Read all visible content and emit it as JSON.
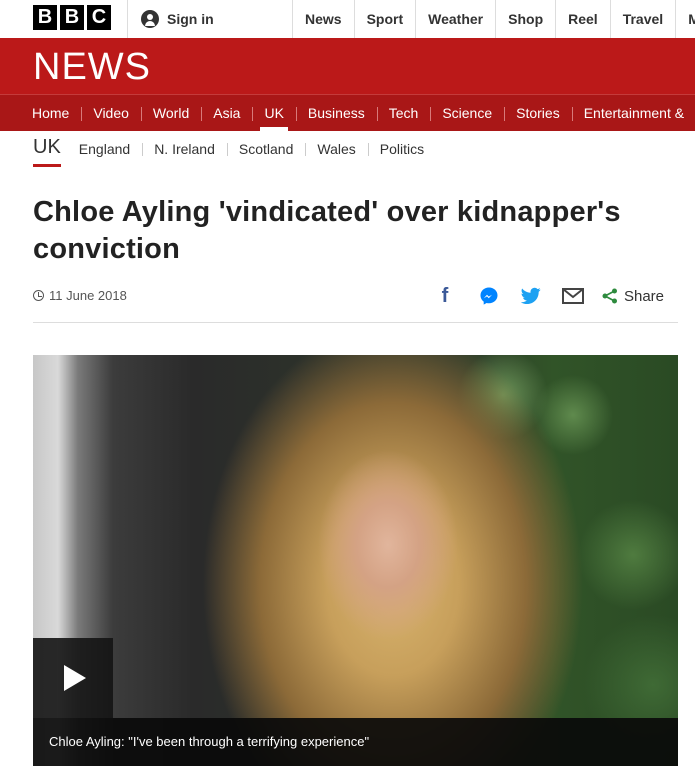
{
  "topbar": {
    "logo_letters": [
      "B",
      "B",
      "C"
    ],
    "sign_in_label": "Sign in",
    "nav": [
      "News",
      "Sport",
      "Weather",
      "Shop",
      "Reel",
      "Travel",
      "Mor"
    ]
  },
  "banner": {
    "title": "NEWS"
  },
  "section_nav": {
    "items": [
      "Home",
      "Video",
      "World",
      "Asia",
      "UK",
      "Business",
      "Tech",
      "Science",
      "Stories",
      "Entertainment &"
    ],
    "active": "UK"
  },
  "sub_nav": {
    "title": "UK",
    "items": [
      "England",
      "N. Ireland",
      "Scotland",
      "Wales",
      "Politics"
    ]
  },
  "article": {
    "headline": "Chloe Ayling 'vindicated' over kidnapper's conviction",
    "date": "11 June 2018",
    "share_label": "Share",
    "share_icons": [
      "facebook-icon",
      "messenger-icon",
      "twitter-icon",
      "email-icon",
      "share-icon"
    ]
  },
  "media": {
    "caption": "Chloe Ayling: \"I've been through a terrifying experience\""
  },
  "colors": {
    "brand_red": "#bb1919",
    "nav_red": "#a91717",
    "facebook": "#3b5998",
    "messenger": "#0084ff",
    "twitter": "#1da1f2",
    "share_green": "#2e8b3e"
  }
}
